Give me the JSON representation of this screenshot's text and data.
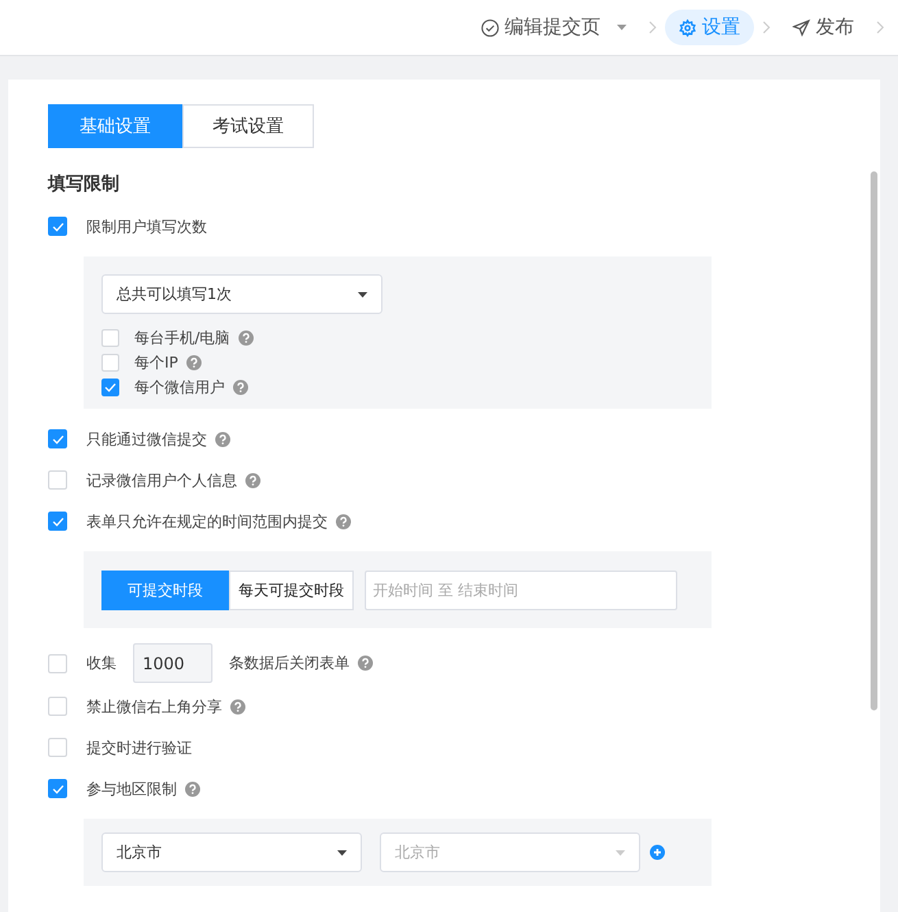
{
  "steps": [
    {
      "label": "编辑提交页",
      "selected": false,
      "dropdown": true
    },
    {
      "label": "设置",
      "selected": true,
      "dropdown": false
    },
    {
      "label": "发布",
      "selected": false,
      "dropdown": false
    }
  ],
  "tabs": [
    {
      "label": "基础设置",
      "selected": true
    },
    {
      "label": "考试设置",
      "selected": false
    }
  ],
  "section_title": "填写限制",
  "options": [
    {
      "kind": "check",
      "label": "限制用户填写次数",
      "checked": true,
      "help": false,
      "panel": {
        "kind": "limit",
        "select": "总共可以填写1次",
        "checks": [
          {
            "label": "每台手机/电脑",
            "checked": false
          },
          {
            "label": "每个IP",
            "checked": false
          },
          {
            "label": "每个微信用户",
            "checked": true
          }
        ]
      }
    },
    {
      "kind": "check",
      "label": "只能通过微信提交",
      "checked": true,
      "help": true
    },
    {
      "kind": "check",
      "label": "记录微信用户个人信息",
      "checked": false,
      "help": true
    },
    {
      "kind": "check",
      "label": "表单只允许在规定的时间范围内提交",
      "checked": true,
      "help": true,
      "panel": {
        "kind": "time",
        "segments": [
          {
            "label": "可提交时段",
            "selected": true
          },
          {
            "label": "每天可提交时段",
            "selected": false
          }
        ],
        "placeholder": "开始时间 至 结束时间"
      }
    },
    {
      "kind": "collect",
      "label": "收集",
      "value": "1000",
      "suffix": "条数据后关闭表单",
      "checked": false,
      "help": true
    },
    {
      "kind": "check",
      "label": "禁止微信右上角分享",
      "checked": false,
      "help": true
    },
    {
      "kind": "check",
      "label": "提交时进行验证",
      "checked": false,
      "help": false
    },
    {
      "kind": "check",
      "label": "参与地区限制",
      "checked": true,
      "help": true,
      "panel": {
        "kind": "region",
        "selects": [
          {
            "value": "北京市",
            "disabled": false
          },
          {
            "value": "北京市",
            "disabled": true
          }
        ]
      }
    }
  ]
}
